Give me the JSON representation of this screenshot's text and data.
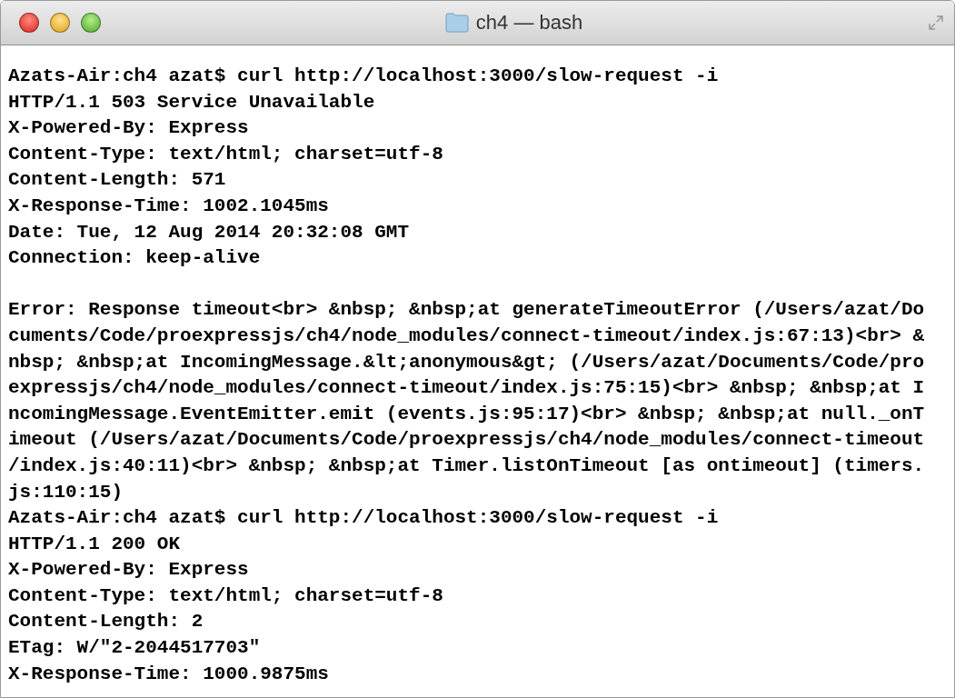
{
  "window": {
    "title": "ch4 — bash"
  },
  "terminal": {
    "sections": [
      [
        "Azats-Air:ch4 azat$ curl http://localhost:3000/slow-request -i",
        "HTTP/1.1 503 Service Unavailable",
        "X-Powered-By: Express",
        "Content-Type: text/html; charset=utf-8",
        "Content-Length: 571",
        "X-Response-Time: 1002.1045ms",
        "Date: Tue, 12 Aug 2014 20:32:08 GMT",
        "Connection: keep-alive"
      ],
      [
        "Error: Response timeout<br> &nbsp; &nbsp;at generateTimeoutError (/Users/azat/Do",
        "cuments/Code/proexpressjs/ch4/node_modules/connect-timeout/index.js:67:13)<br> &",
        "nbsp; &nbsp;at IncomingMessage.&lt;anonymous&gt; (/Users/azat/Documents/Code/pro",
        "expressjs/ch4/node_modules/connect-timeout/index.js:75:15)<br> &nbsp; &nbsp;at I",
        "ncomingMessage.EventEmitter.emit (events.js:95:17)<br> &nbsp; &nbsp;at null._onT",
        "imeout (/Users/azat/Documents/Code/proexpressjs/ch4/node_modules/connect-timeout",
        "/index.js:40:11)<br> &nbsp; &nbsp;at Timer.listOnTimeout [as ontimeout] (timers.",
        "js:110:15)",
        "Azats-Air:ch4 azat$ curl http://localhost:3000/slow-request -i",
        "HTTP/1.1 200 OK",
        "X-Powered-By: Express",
        "Content-Type: text/html; charset=utf-8",
        "Content-Length: 2",
        "ETag: W/\"2-2044517703\"",
        "X-Response-Time: 1000.9875ms"
      ]
    ]
  }
}
